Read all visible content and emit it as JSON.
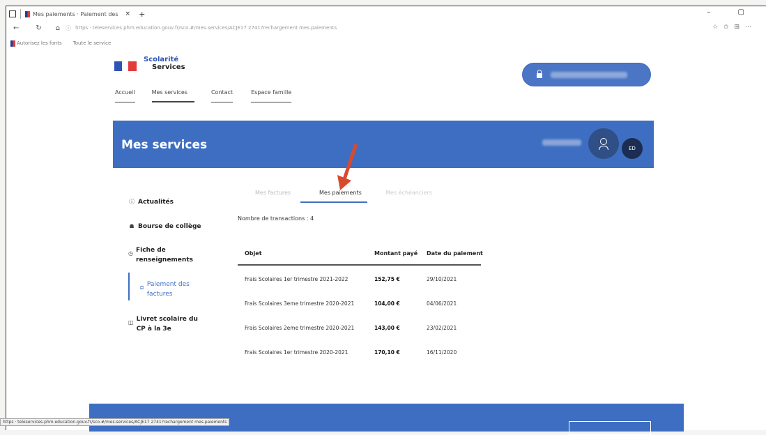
{
  "browser": {
    "tab_title": "Mes paiements · Paiement des",
    "tab_close": "×",
    "new_tab": "+",
    "window_controls": "– ▢",
    "address": "https · teleservices.phm.education.gouv.fr/sco.#/mes.services/ACJE17 2741?rechargement mes.paiements",
    "bookmarks": [
      "Autorisez les fonts",
      "Toute le service"
    ],
    "status_url": "https · teleservices.phm.education.gouv.fr/sco.#/mes.services/ACJE17 2741?rechargement mes.paiements"
  },
  "site": {
    "logo_line1": "Scolarité",
    "logo_line2": "Services",
    "flag_colors": [
      "#2d55b4",
      "#ffffff",
      "#e33a3a"
    ],
    "nav": [
      "Accueil",
      "Mes services",
      "Contact",
      "Espace famille"
    ]
  },
  "banner": {
    "title": "Mes services",
    "avatar_initials": "ED",
    "color": "#3e6ec1"
  },
  "sidebar": {
    "items": [
      {
        "icon": "info-icon",
        "label": "Actualités"
      },
      {
        "icon": "bourse-icon",
        "label": "Bourse de collège"
      },
      {
        "icon": "form-icon",
        "label": "Fiche de renseignements"
      },
      {
        "icon": "payment-icon",
        "label": "Paiement des factures"
      },
      {
        "icon": "book-icon",
        "label": "Livret scolaire du CP à la 3e"
      }
    ]
  },
  "subtabs": [
    "Mes factures",
    "Mes paiements",
    "Mes échéanciers"
  ],
  "transactions": {
    "count_label": "Nombre de transactions : 4",
    "headers": [
      "Objet",
      "Montant payé",
      "Date du paiement"
    ],
    "rows": [
      {
        "objet": "Frais Scolaires 1er trimestre 2021-2022",
        "montant": "152,75 €",
        "date": "29/10/2021"
      },
      {
        "objet": "Frais Scolaires 3eme trimestre 2020-2021",
        "montant": "104,00 €",
        "date": "04/06/2021"
      },
      {
        "objet": "Frais Scolaires 2eme trimestre 2020-2021",
        "montant": "143,00 €",
        "date": "23/02/2021"
      },
      {
        "objet": "Frais Scolaires 1er trimestre 2020-2021",
        "montant": "170,10 €",
        "date": "16/11/2020"
      }
    ]
  },
  "annotation_color": "#d84a2e"
}
